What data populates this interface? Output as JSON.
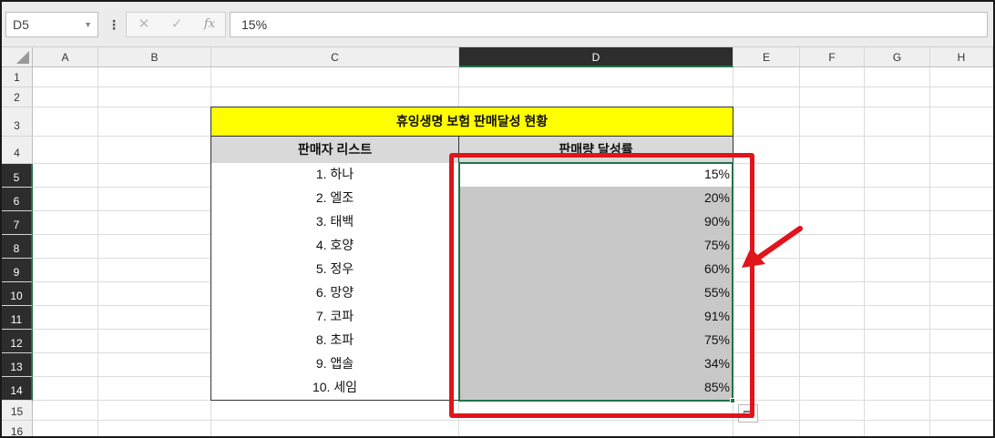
{
  "namebox": {
    "value": "D5",
    "dropdown_icon": "chevron-down-icon"
  },
  "formula_bar": {
    "menu_icon": "more-vertical-icon",
    "cancel_icon": "close-icon",
    "enter_icon": "check-icon",
    "fx_label": "fx",
    "value": "15%"
  },
  "columns": [
    "A",
    "B",
    "C",
    "D",
    "E",
    "F",
    "G",
    "H"
  ],
  "rows": [
    "1",
    "2",
    "3",
    "4",
    "5",
    "6",
    "7",
    "8",
    "9",
    "10",
    "11",
    "12",
    "13",
    "14",
    "15",
    "16"
  ],
  "sheet": {
    "title": "휴잉생명 보험 판매달성 현황",
    "headers": {
      "name": "판매자 리스트",
      "rate": "판매량 달성률"
    },
    "records": [
      {
        "name": "1. 하나",
        "rate": "15%"
      },
      {
        "name": "2. 엘조",
        "rate": "20%"
      },
      {
        "name": "3. 태백",
        "rate": "90%"
      },
      {
        "name": "4. 호양",
        "rate": "75%"
      },
      {
        "name": "5. 정우",
        "rate": "60%"
      },
      {
        "name": "6. 망양",
        "rate": "55%"
      },
      {
        "name": "7. 코파",
        "rate": "91%"
      },
      {
        "name": "8. 초파",
        "rate": "75%"
      },
      {
        "name": "9. 앱솔",
        "rate": "34%"
      },
      {
        "name": "10. 세임",
        "rate": "85%"
      }
    ]
  },
  "colors": {
    "title_fill": "#ffff00",
    "header_fill": "#d9d9d9",
    "value_fill": "#c8c8c8",
    "selection": "#217346",
    "annotation": "#e0141b"
  }
}
